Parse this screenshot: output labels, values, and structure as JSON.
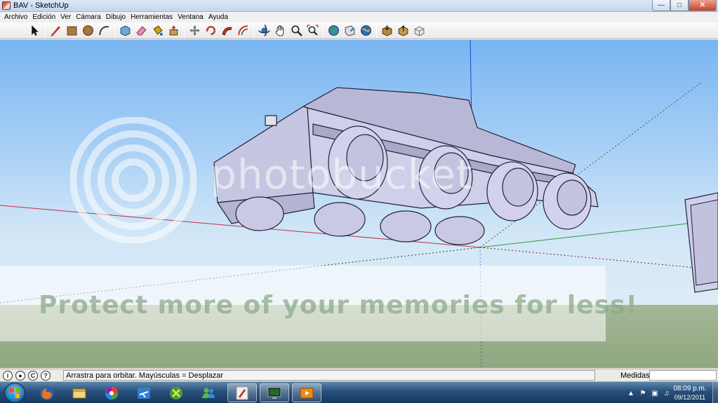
{
  "window": {
    "title": "BAV - SketchUp"
  },
  "menu": [
    "Archivo",
    "Edición",
    "Ver",
    "Cámara",
    "Dibujo",
    "Herramientas",
    "Ventana",
    "Ayuda"
  ],
  "toolbar": {
    "tools": [
      {
        "name": "select-tool",
        "icon": "arrow-icon"
      },
      {
        "name": "line-tool",
        "icon": "pencil-icon"
      },
      {
        "name": "rectangle-tool",
        "icon": "rectangle-icon"
      },
      {
        "name": "circle-tool",
        "icon": "circle-icon"
      },
      {
        "name": "arc-tool",
        "icon": "arc-icon"
      },
      {
        "name": "make-component-tool",
        "icon": "component-icon"
      },
      {
        "name": "eraser-tool",
        "icon": "eraser-icon"
      },
      {
        "name": "paint-bucket-tool",
        "icon": "paint-bucket-icon"
      },
      {
        "name": "push-pull-tool",
        "icon": "push-pull-icon"
      },
      {
        "name": "move-tool",
        "icon": "move-icon"
      },
      {
        "name": "rotate-tool",
        "icon": "rotate-icon"
      },
      {
        "name": "follow-me-tool",
        "icon": "follow-me-icon"
      },
      {
        "name": "offset-tool",
        "icon": "offset-icon"
      },
      {
        "name": "orbit-tool",
        "icon": "orbit-icon"
      },
      {
        "name": "pan-tool",
        "icon": "hand-icon"
      },
      {
        "name": "zoom-tool",
        "icon": "zoom-icon"
      },
      {
        "name": "zoom-extents-tool",
        "icon": "zoom-extents-icon"
      },
      {
        "name": "get-models-tool",
        "icon": "globe-icon"
      },
      {
        "name": "share-model-tool",
        "icon": "share-icon"
      },
      {
        "name": "google-earth-tool",
        "icon": "earth-icon"
      },
      {
        "name": "get-components-tool",
        "icon": "box-down-icon"
      },
      {
        "name": "share-component-tool",
        "icon": "box-up-icon"
      },
      {
        "name": "extension-tool",
        "icon": "cube-icon"
      }
    ]
  },
  "watermark": {
    "brand": "photobucket",
    "promo": "Protect more of your memories for less!"
  },
  "statusbar": {
    "hint": "Arrastra para orbitar.  Mayúsculas = Desplazar",
    "measure_label": "Medidas",
    "measure_value": ""
  },
  "taskbar": {
    "apps": [
      "firefox-icon",
      "explorer-icon",
      "picasa-icon",
      "aircraft-icon",
      "spreadsheet-icon",
      "messenger-icon",
      "sketchup-icon",
      "monitor-icon",
      "media-player-icon"
    ],
    "active_app": "sketchup-icon",
    "clock": {
      "time": "08:09 p.m.",
      "date": "09/12/2011"
    }
  },
  "colors": {
    "sky_top": "#78b5f2",
    "ground": "#a5b796",
    "model_face": "#c9c9e6",
    "axis_red": "#c0304a",
    "axis_green": "#2e9b3c",
    "axis_blue": "#2a3fd6"
  }
}
